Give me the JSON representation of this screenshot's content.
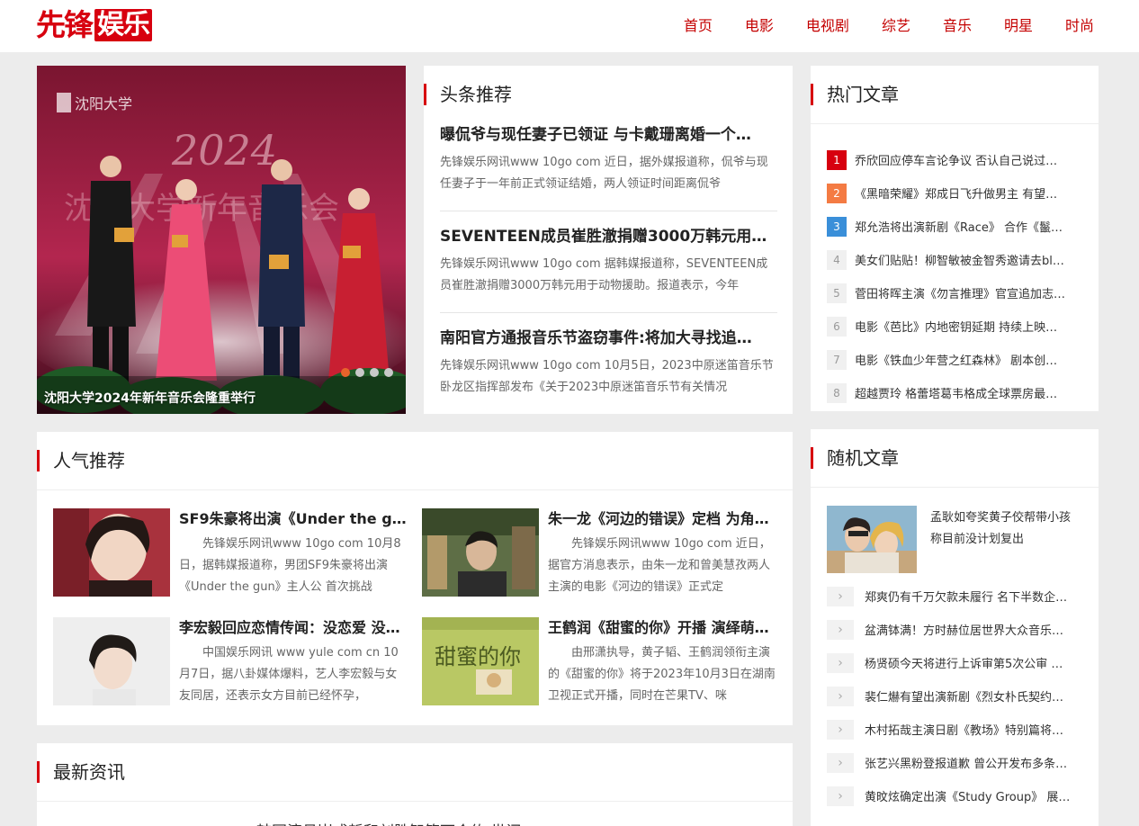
{
  "logo": {
    "part1": "先锋",
    "part2": "娱乐"
  },
  "nav": [
    "首页",
    "电影",
    "电视剧",
    "综艺",
    "音乐",
    "明星",
    "时尚"
  ],
  "slider": {
    "caption": "沈阳大学2024年新年音乐会隆重举行",
    "image_text": {
      "seal": "沈阳大学",
      "banner": "2024",
      "backdrop": "沈阳大学新年音乐会"
    },
    "dots": 4,
    "active_dot": 0
  },
  "headlines": {
    "title": "头条推荐",
    "items": [
      {
        "title": "曝侃爷与现任妻子已领证 与卡戴珊离婚一个…",
        "desc": "先锋娱乐网讯www 10go com 近日，据外媒报道称，侃爷与现任妻子于一年前正式领证结婚，两人领证时间距离侃爷"
      },
      {
        "title": "SEVENTEEN成员崔胜澈捐赠3000万韩元用…",
        "desc": "先锋娱乐网讯www 10go com 据韩媒报道称，SEVENTEEN成员崔胜澈捐赠3000万韩元用于动物援助。报道表示，今年"
      },
      {
        "title": "南阳官方通报音乐节盗窃事件:将加大寻找追…",
        "desc": "先锋娱乐网讯www 10go com 10月5日，2023中原迷笛音乐节卧龙区指挥部发布《关于2023中原迷笛音乐节有关情况"
      }
    ]
  },
  "hot": {
    "title": "热门文章",
    "items": [
      {
        "rank": "1",
        "text": "乔欣回应停车言论争议 否认自己说过…"
      },
      {
        "rank": "2",
        "text": "《黑暗荣耀》郑成日飞升做男主 有望…"
      },
      {
        "rank": "3",
        "text": "郑允浩将出演新剧《Race》 合作《鬣…"
      },
      {
        "rank": "4",
        "text": "美女们贴贴！柳智敏被金智秀邀请去bl…"
      },
      {
        "rank": "5",
        "text": "菅田将晖主演《勿言推理》官宣追加志…"
      },
      {
        "rank": "6",
        "text": "电影《芭比》内地密钥延期 持续上映…"
      },
      {
        "rank": "7",
        "text": "电影《铁血少年营之红森林》 剧本创…"
      },
      {
        "rank": "8",
        "text": "超越贾玲 格蕾塔葛韦格成全球票房最…"
      }
    ]
  },
  "popular": {
    "title": "人气推荐",
    "items": [
      {
        "title": "SF9朱豪将出演《Under the gu…",
        "desc": "先锋娱乐网讯www 10go com 10月8日，据韩媒报道称，男团SF9朱豪将出演《Under the gun》主人公 首次挑战"
      },
      {
        "title": "朱一龙《河边的错误》定档 为角…",
        "desc": "先锋娱乐网讯www 10go com 近日，据官方消息表示，由朱一龙和曾美慧孜两人主演的电影《河边的错误》正式定"
      },
      {
        "title": "李宏毅回应恋情传闻：没恋爱 没…",
        "desc": "中国娱乐网讯 www yule com cn 10月7日，据八卦媒体爆料，艺人李宏毅与女友同居，还表示女方目前已经怀孕，"
      },
      {
        "title": "王鹤润《甜蜜的你》开播 演绎萌…",
        "desc": "由邢潇执导，黄子韬、王鹤润领衔主演的《甜蜜的你》将于2023年10月3日在湖南卫视正式开播，同时在芒果TV、咪",
        "image_text": "甜蜜的你"
      }
    ]
  },
  "random": {
    "title": "随机文章",
    "top": {
      "title": "孟耿如夸奖黄子佼帮带小孩 称目前没计划复出"
    },
    "chevron": "›",
    "items": [
      "郑爽仍有千万欠款未履行 名下半数企…",
      "盆满钵满！方时赫位居世界大众音乐…",
      "杨贤硕今天将进行上诉审第5次公审 …",
      "裴仁爀有望出演新剧《烈女朴氏契约…",
      "木村拓哉主演日剧《教场》特别篇将…",
      "张艺兴黑粉登报道歉 曾公开发布多条…",
      "黄旼炫确定出演《Study Group》 展…"
    ]
  },
  "latest": {
    "title": "最新资讯",
    "peek": "韩国演员崔成哲和刘胜智签下合约 世间"
  },
  "colors": {
    "brand": "#d7000f",
    "nav": "#c40000",
    "rank2": "#f47b43",
    "rank3": "#3a8fd9",
    "dot_active": "#e8632b"
  }
}
